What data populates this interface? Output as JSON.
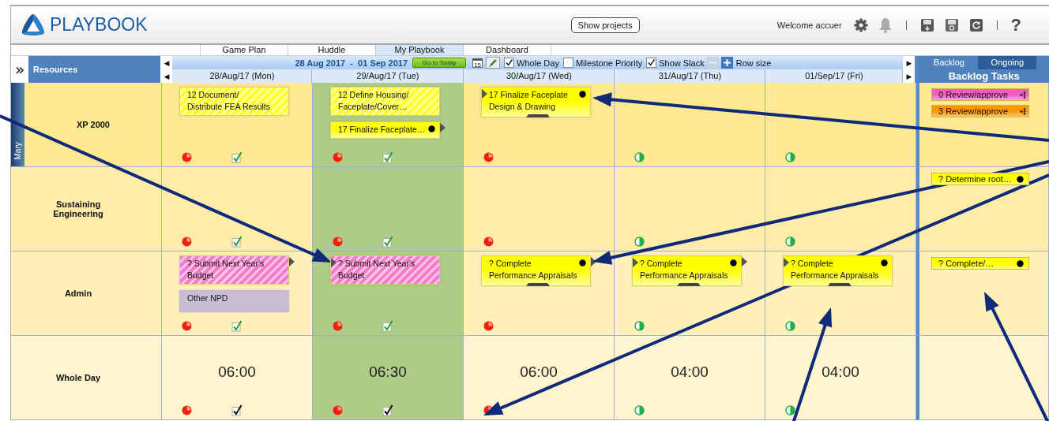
{
  "header": {
    "logo": "PLAYBOOK",
    "show_projects": "Show projects",
    "welcome": "Welcome accuer",
    "help": "?"
  },
  "nav_tabs": [
    {
      "label": "Game Plan",
      "selected": false
    },
    {
      "label": "Huddle",
      "selected": false
    },
    {
      "label": "My Playbook",
      "selected": true
    },
    {
      "label": "Dashboard",
      "selected": false
    }
  ],
  "resources_header": {
    "expand": "»",
    "title": "Resources"
  },
  "toolbar": {
    "prev": "◀",
    "date_range": "28 Aug 2017  -  01 Sep 2017",
    "go_today": "Go to Today",
    "calendar_day": "15",
    "options": [
      {
        "label": "Whole Day",
        "checked": true
      },
      {
        "label": "Milestone Priority",
        "checked": false
      },
      {
        "label": "Show Slack",
        "checked": true
      }
    ],
    "row_size": "Row size",
    "next": "▶"
  },
  "day_prev": "◀",
  "day_next": "▶",
  "days": [
    {
      "label": "28/Aug/17 (Mon)",
      "highlighted": false
    },
    {
      "label": "29/Aug/17 (Tue)",
      "highlighted": true
    },
    {
      "label": "30/Aug/17 (Wed)",
      "highlighted": false
    },
    {
      "label": "31/Aug/17 (Thu)",
      "highlighted": false
    },
    {
      "label": "01/Sep/17 (Fri)",
      "highlighted": false
    }
  ],
  "backlog": {
    "tabs": [
      {
        "label": "Backlog",
        "selected": false
      },
      {
        "label": "Ongoing",
        "selected": true
      }
    ],
    "title": "Backlog Tasks"
  },
  "rows": [
    {
      "kind": "resource",
      "name": "XP 2000",
      "owner": "Mary",
      "cells": [
        {
          "tasks": [
            {
              "text": "12 Document/\nDistribute FEA Results",
              "kind": "hatched",
              "color": "#ffff2e",
              "pointer_left": false,
              "pointer_right": false,
              "dot": false,
              "handle": false
            }
          ],
          "on_track": false,
          "checked": true,
          "approved": true
        },
        {
          "tasks": [
            {
              "text": "12 Define Housing/\nFaceplate/Cover…",
              "kind": "hatched",
              "color": "#ffff2e",
              "pointer_left": false,
              "pointer_right": false,
              "dot": false,
              "handle": false
            },
            {
              "text": "17 Finalize Faceplate…",
              "kind": "gradient",
              "color": "#ffff00",
              "pointer_left": false,
              "pointer_right": true,
              "dot": true,
              "handle": false
            }
          ],
          "on_track": false,
          "checked": true,
          "approved": true
        },
        {
          "tasks": [
            {
              "text": "17 Finalize Faceplate\nDesign & Drawing",
              "kind": "gradient",
              "color": "#ffff00",
              "pointer_left": true,
              "pointer_right": false,
              "dot": true,
              "handle": true
            }
          ],
          "on_track": false,
          "checked": false
        },
        {
          "on_track": true,
          "checked": false
        },
        {
          "on_track": true,
          "checked": false
        }
      ],
      "backlog_tasks": [
        {
          "text": "0 Review/approve",
          "color": "#f25cbc",
          "dot": false,
          "menu": true
        },
        {
          "text": "3 Review/approve",
          "color": "#ff9800",
          "dot": false,
          "menu": true
        }
      ]
    },
    {
      "kind": "resource",
      "name": "Sustaining\nEngineering",
      "cells": [
        {
          "on_track": false,
          "checked": true,
          "approved": true
        },
        {
          "on_track": false,
          "checked": true,
          "approved": true
        },
        {
          "on_track": false,
          "checked": false
        },
        {
          "on_track": true,
          "checked": false
        },
        {
          "on_track": true,
          "checked": false
        }
      ],
      "backlog_tasks": [
        {
          "text": "? Determine root…",
          "color": "#ffff00",
          "dot": true,
          "menu": false
        }
      ]
    },
    {
      "kind": "resource",
      "name": "Admin",
      "cells": [
        {
          "tasks": [
            {
              "text": "? Submit Next Year's\nBudget",
              "kind": "hatched",
              "color": "#f47cc8",
              "pointer_left": false,
              "pointer_right": true,
              "dot": false,
              "handle": false
            },
            {
              "text": "Other NPD",
              "kind": "plain",
              "color": "#c9bdd3",
              "pointer_left": false,
              "pointer_right": false,
              "dot": false,
              "handle": false
            }
          ],
          "on_track": false,
          "checked": true,
          "approved": true
        },
        {
          "tasks": [
            {
              "text": "? Submit Next Year's\nBudget",
              "kind": "hatched",
              "color": "#f47cc8",
              "pointer_left": true,
              "pointer_right": false,
              "dot": false,
              "handle": false
            }
          ],
          "on_track": false,
          "checked": true,
          "approved": true
        },
        {
          "tasks": [
            {
              "text": "? Complete\nPerformance Appraisals",
              "kind": "gradient",
              "color": "#ffff00",
              "pointer_left": false,
              "pointer_right": true,
              "dot": true,
              "handle": true
            }
          ],
          "on_track": false,
          "checked": false
        },
        {
          "tasks": [
            {
              "text": "? Complete\nPerformance Appraisals",
              "kind": "gradient",
              "color": "#ffff00",
              "pointer_left": true,
              "pointer_right": true,
              "dot": true,
              "handle": true
            }
          ],
          "on_track": true,
          "checked": false
        },
        {
          "tasks": [
            {
              "text": "? Complete\nPerformance Appraisals",
              "kind": "gradient",
              "color": "#ffff00",
              "pointer_left": true,
              "pointer_right": false,
              "dot": true,
              "handle": true
            }
          ],
          "on_track": true,
          "checked": false
        }
      ],
      "backlog_tasks": [
        {
          "text": "? Complete/…",
          "color": "#ffff00",
          "dot": true,
          "menu": false
        }
      ]
    },
    {
      "kind": "total",
      "name": "Whole Day",
      "cells": [
        {
          "hours": "06:00",
          "on_track": false,
          "checked": true,
          "approved": false
        },
        {
          "hours": "06:30",
          "on_track": false,
          "checked": true,
          "approved": false
        },
        {
          "hours": "06:00",
          "on_track": false,
          "checked": false
        },
        {
          "hours": "04:00",
          "on_track": true,
          "checked": false
        },
        {
          "hours": "04:00",
          "on_track": true,
          "checked": false
        }
      ]
    }
  ]
}
